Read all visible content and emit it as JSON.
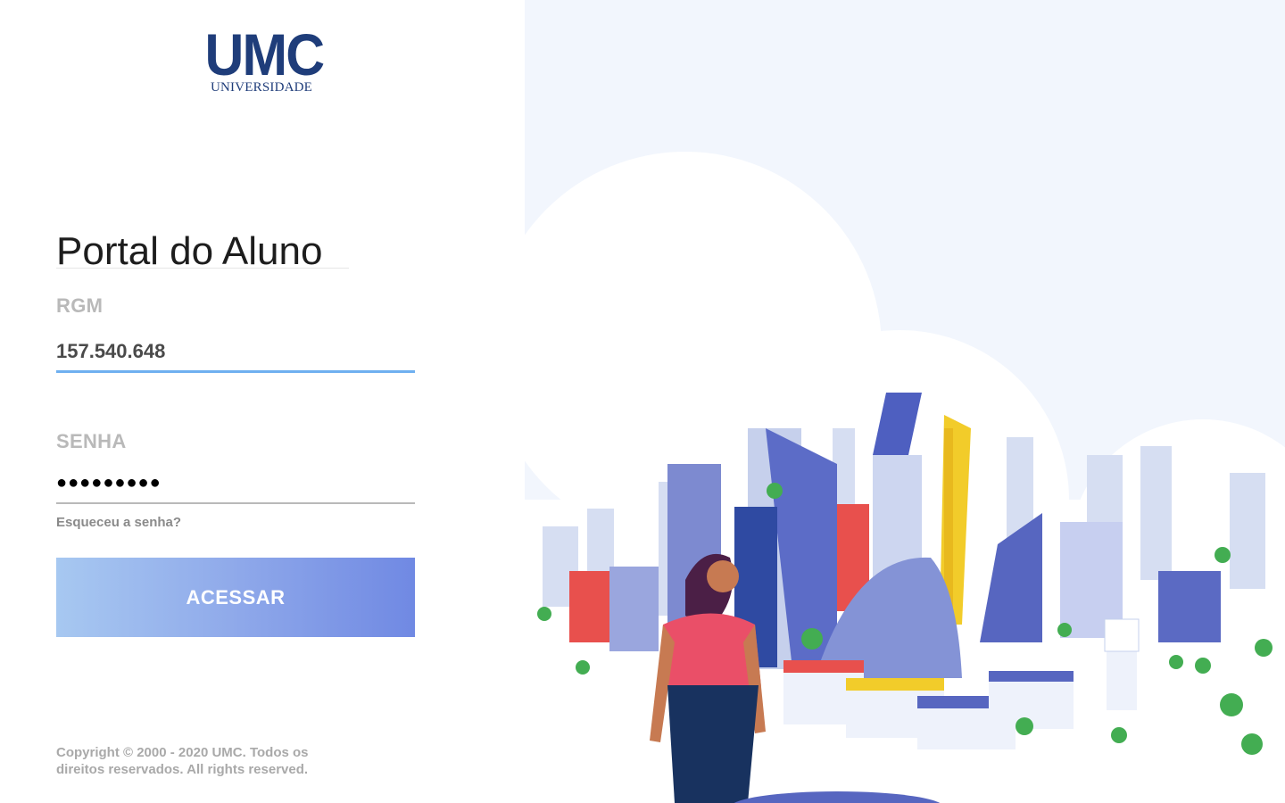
{
  "brand": {
    "name": "UMC",
    "subtitle": "UNIVERSIDADE"
  },
  "page": {
    "title": "Portal do Aluno"
  },
  "form": {
    "rgm": {
      "label": "RGM",
      "value": "157.540.648"
    },
    "senha": {
      "label": "SENHA",
      "masked_value": "●●●●●●●●●"
    },
    "forgot_link": "Esqueceu a senha?",
    "submit_label": "ACESSAR"
  },
  "footer": {
    "copyright": "Copyright © 2000 - 2020 UMC. Todos os direitos reservados. All rights reserved."
  },
  "colors": {
    "brand_navy": "#1f3d7a",
    "input_focus": "#6fb0f0",
    "button_gradient_start": "#a7c8f1",
    "button_gradient_end": "#7089e3",
    "illustration_bg": "#f2f6fd"
  },
  "illustration": {
    "name": "city-campus-illustration"
  }
}
